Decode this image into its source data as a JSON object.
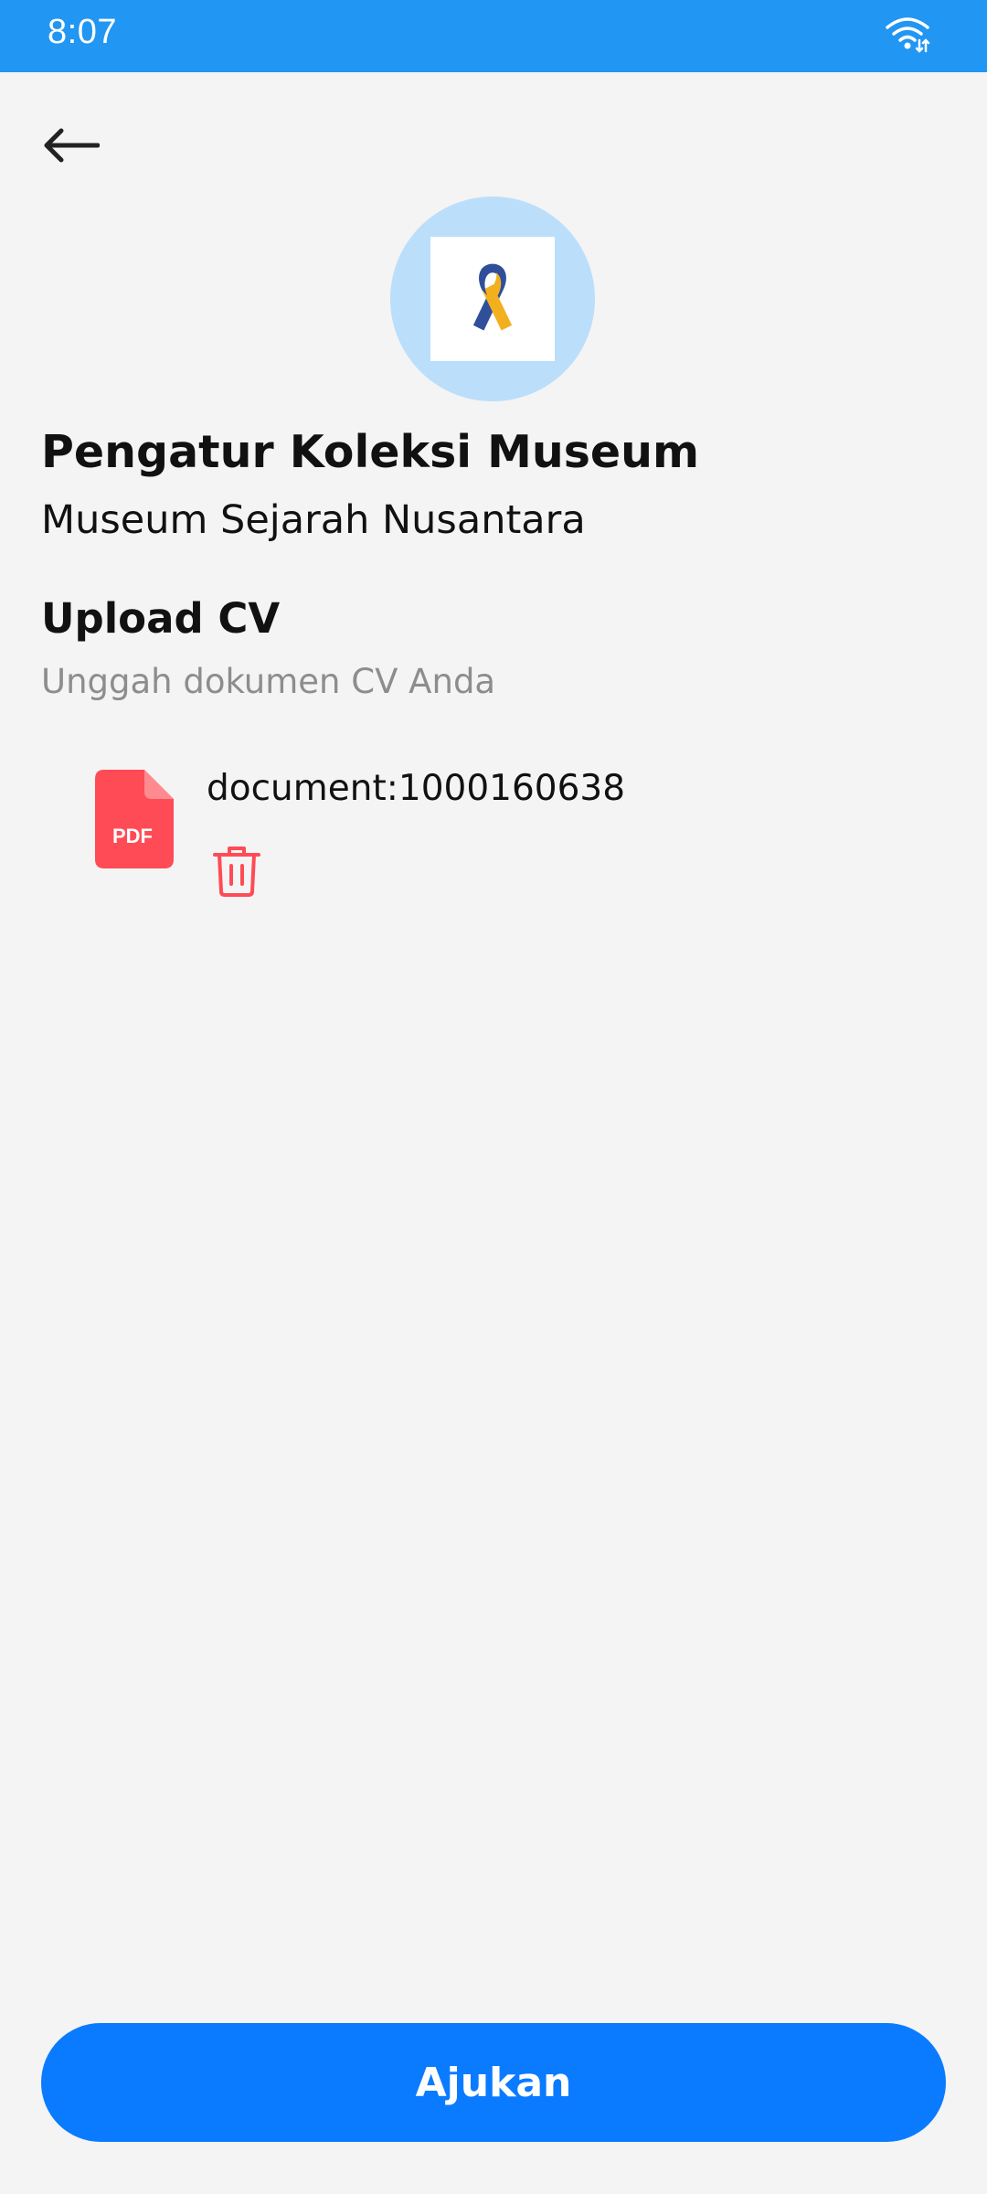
{
  "status_bar": {
    "time": "8:07",
    "icons": [
      "wifi-icon"
    ],
    "background_color": "#2196f3"
  },
  "header": {
    "back_icon": "arrow-left-icon"
  },
  "job": {
    "logo_icon": "awareness-ribbon-icon",
    "title": "Pengatur Koleksi Museum",
    "company": "Museum Sejarah Nusantara"
  },
  "upload_section": {
    "title": "Upload CV",
    "subtitle": "Unggah dokumen CV Anda"
  },
  "uploaded_file": {
    "icon": "pdf-file-icon",
    "icon_label": "PDF",
    "name": "document:1000160638",
    "delete_icon": "trash-icon",
    "icon_color": "#ff4b55"
  },
  "actions": {
    "submit_label": "Ajukan",
    "submit_color": "#0a7bff"
  }
}
